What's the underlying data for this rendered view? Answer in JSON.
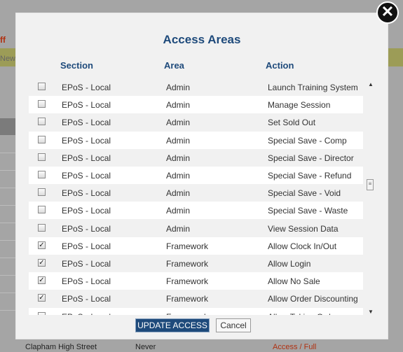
{
  "background": {
    "staff_text": "ff",
    "new_text": "New",
    "bottom_row": {
      "site": "Clapham High Street",
      "value": "Never",
      "link": "Access / Full"
    }
  },
  "dialog": {
    "title": "Access Areas",
    "columns": [
      "Section",
      "Area",
      "Action"
    ],
    "rows": [
      {
        "checked": false,
        "section": "EPoS - Local",
        "area": "Admin",
        "action": "Launch Training System"
      },
      {
        "checked": false,
        "section": "EPoS - Local",
        "area": "Admin",
        "action": "Manage Session"
      },
      {
        "checked": false,
        "section": "EPoS - Local",
        "area": "Admin",
        "action": "Set Sold Out"
      },
      {
        "checked": false,
        "section": "EPoS - Local",
        "area": "Admin",
        "action": "Special Save - Comp"
      },
      {
        "checked": false,
        "section": "EPoS - Local",
        "area": "Admin",
        "action": "Special Save - Director"
      },
      {
        "checked": false,
        "section": "EPoS - Local",
        "area": "Admin",
        "action": "Special Save - Refund"
      },
      {
        "checked": false,
        "section": "EPoS - Local",
        "area": "Admin",
        "action": "Special Save - Void"
      },
      {
        "checked": false,
        "section": "EPoS - Local",
        "area": "Admin",
        "action": "Special Save - Waste"
      },
      {
        "checked": false,
        "section": "EPoS - Local",
        "area": "Admin",
        "action": "View Session Data"
      },
      {
        "checked": true,
        "section": "EPoS - Local",
        "area": "Framework",
        "action": "Allow Clock In/Out"
      },
      {
        "checked": true,
        "section": "EPoS - Local",
        "area": "Framework",
        "action": "Allow Login"
      },
      {
        "checked": true,
        "section": "EPoS - Local",
        "area": "Framework",
        "action": "Allow No Sale"
      },
      {
        "checked": true,
        "section": "EPoS - Local",
        "area": "Framework",
        "action": "Allow Order Discounting"
      },
      {
        "checked": false,
        "section": "EPoS - Local",
        "area": "Framework",
        "action": "Allow Taking Orders"
      }
    ],
    "update_label": "UPDATE ACCESS",
    "cancel_label": "Cancel",
    "close_glyph": "✕",
    "check_glyph": "✓"
  }
}
